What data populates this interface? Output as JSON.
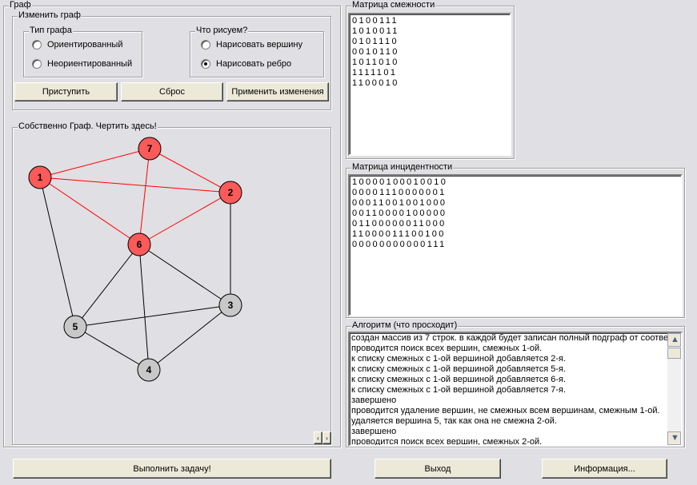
{
  "graph_group": {
    "title": "Граф"
  },
  "edit_group": {
    "title": "Изменить граф",
    "type_group": {
      "title": "Тип графа",
      "options": [
        "Ориентированный",
        "Неориентированный"
      ],
      "selected": null
    },
    "draw_group": {
      "title": "Что рисуем?",
      "options": [
        "Нарисовать вершину",
        "Нарисовать ребро"
      ],
      "selected": 1
    },
    "buttons": {
      "start": "Приступить",
      "reset": "Сброс",
      "apply": "Применить изменения"
    }
  },
  "canvas_group": {
    "title": "Собственно Граф. Чертить здесь!"
  },
  "graph": {
    "colors": {
      "highlight": "#ff5a5a",
      "normal": "#c8c8c8",
      "highlight_edge": "#ff0000",
      "normal_edge": "#000000"
    },
    "nodes": [
      {
        "label": "1",
        "highlighted": true
      },
      {
        "label": "2",
        "highlighted": true
      },
      {
        "label": "3",
        "highlighted": false
      },
      {
        "label": "4",
        "highlighted": false
      },
      {
        "label": "5",
        "highlighted": false
      },
      {
        "label": "6",
        "highlighted": true
      },
      {
        "label": "7",
        "highlighted": true
      }
    ],
    "edges": [
      [
        1,
        7,
        true
      ],
      [
        1,
        2,
        true
      ],
      [
        1,
        6,
        true
      ],
      [
        7,
        2,
        true
      ],
      [
        7,
        6,
        true
      ],
      [
        2,
        6,
        true
      ],
      [
        1,
        5,
        false
      ],
      [
        2,
        3,
        false
      ],
      [
        6,
        5,
        false
      ],
      [
        6,
        3,
        false
      ],
      [
        6,
        4,
        false
      ],
      [
        5,
        3,
        false
      ],
      [
        5,
        4,
        false
      ],
      [
        4,
        3,
        false
      ]
    ]
  },
  "adjacency": {
    "title": "Матрица смежности",
    "rows": [
      "0100111",
      "1010011",
      "0101110",
      "0010110",
      "1011010",
      "1111101",
      "1100010"
    ]
  },
  "incidence": {
    "title": "Матрица инцидентности",
    "rows": [
      "10000100010010",
      "00001110000001",
      "00011001001000",
      "00110000100000",
      "01100000011000",
      "11000011100100",
      "00000000000111"
    ]
  },
  "algorithm": {
    "title": "Алгоритм (что просходит)",
    "lines": [
      "создан массив из 7 строк. в каждой будет записан полный подграф от соотве",
      "проводится поиск всех вершин, смежных 1-ой.",
      "к списку смежных с 1-ой вершиной добавляется 2-я.",
      "к списку смежных с 1-ой вершиной добавляется 5-я.",
      "к списку смежных с 1-ой вершиной добавляется 6-я.",
      "к списку смежных с 1-ой вершиной добавляется 7-я.",
      "завершено",
      "проводится удаление вершин, не смежных всем вершинам, смежным 1-ой.",
      "удаляется вершина 5, так как она не смежна 2-ой.",
      "завершено",
      "проводится поиск всех вершин, смежных 2-ой."
    ]
  },
  "footer": {
    "run": "Выполнить задачу!",
    "exit": "Выход",
    "info": "Информация..."
  }
}
